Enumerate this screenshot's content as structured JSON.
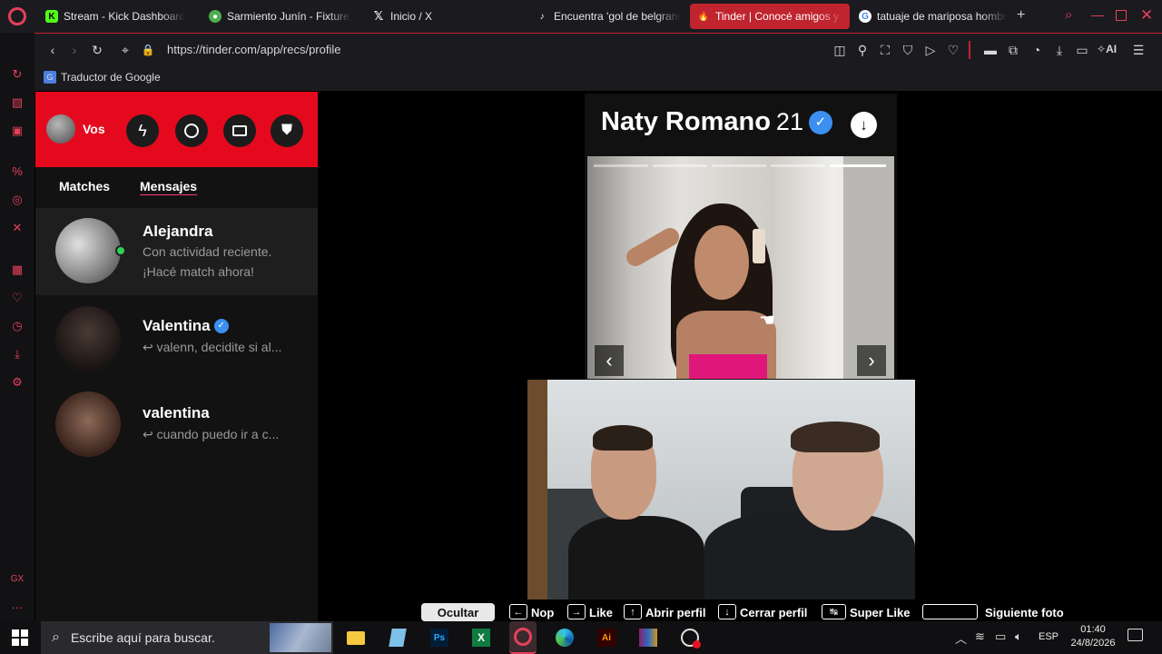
{
  "tabs": [
    {
      "label": "Stream - Kick Dashboard",
      "icon": "kick-icon",
      "color": "#53fc18"
    },
    {
      "label": "Sarmiento Junín - Fixture,",
      "icon": "soccer-icon",
      "color": "#4caf50"
    },
    {
      "label": "Inicio / X",
      "icon": "x-icon",
      "color": "#ffffff"
    },
    {
      "label": "Encuentra 'gol de belgrano",
      "icon": "tiktok-icon",
      "color": "#ffffff"
    },
    {
      "label": "Tinder | Conocé amigos y c",
      "icon": "tinder-icon",
      "color": "#ff4458"
    },
    {
      "label": "tatuaje de mariposa hombr",
      "icon": "google-icon",
      "color": "#4285f4"
    }
  ],
  "address": {
    "url": "https://tinder.com/app/recs/profile",
    "ai_label": "AI"
  },
  "bookmarks": {
    "translator": "Traductor de Google"
  },
  "tinder": {
    "accent": "#e5091e",
    "user_label": "Vos",
    "tabs": {
      "matches": "Matches",
      "messages": "Mensajes"
    },
    "conversations": [
      {
        "name": "Alejandra",
        "line1": "Con actividad reciente.",
        "line2": "¡Hacé match ahora!",
        "online": true,
        "verified": false
      },
      {
        "name": "Valentina",
        "message": "valenn, decidite si al...",
        "verified": true
      },
      {
        "name": "valentina",
        "message": "cuando puedo ir a c...",
        "verified": false
      }
    ],
    "profile": {
      "name": "Naty Romano",
      "age": "21",
      "photos_total": 5,
      "photo_current": 5
    }
  },
  "shortcuts": {
    "hide": "Ocultar",
    "items": [
      {
        "key": "←",
        "label": "Nop"
      },
      {
        "key": "→",
        "label": "Like"
      },
      {
        "key": "↑",
        "label": "Abrir perfil"
      },
      {
        "key": "↓",
        "label": "Cerrar perfil"
      },
      {
        "key": "↹",
        "label": "Super Like"
      },
      {
        "key": "",
        "label": "Siguiente foto"
      }
    ]
  },
  "taskbar": {
    "search_placeholder": "Escribe aquí para buscar.",
    "language": "ESP",
    "time": "01:40",
    "date": "24/8/2026",
    "apps": [
      "file-explorer-icon",
      "notepad-icon",
      "photoshop-icon",
      "excel-icon",
      "opera-icon",
      "edge-icon",
      "illustrator-icon",
      "winrar-icon",
      "obs-icon"
    ]
  }
}
